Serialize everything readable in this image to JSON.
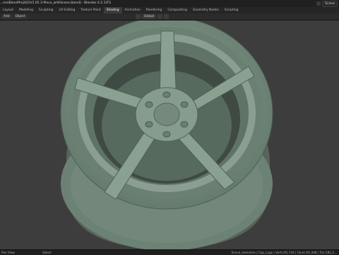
{
  "window": {
    "title": "...ms\\BlendProj\\02\\V1.05 3-Piece_withScene.blend] - Blender 4.2.1LTS",
    "scene_label": "Scene"
  },
  "workspace_tabs": [
    {
      "label": "Layout",
      "active": false
    },
    {
      "label": "Modeling",
      "active": false
    },
    {
      "label": "Sculpting",
      "active": false
    },
    {
      "label": "UV Editing",
      "active": false
    },
    {
      "label": "Texture Paint",
      "active": false
    },
    {
      "label": "Shading",
      "active": true
    },
    {
      "label": "Animation",
      "active": false
    },
    {
      "label": "Rendering",
      "active": false
    },
    {
      "label": "Compositing",
      "active": false
    },
    {
      "label": "Geometry Nodes",
      "active": false
    },
    {
      "label": "Scripting",
      "active": false
    }
  ],
  "header": {
    "add_menu": "Add",
    "object_menu": "Object",
    "orientation": "Global"
  },
  "viewport": {
    "background": "#3d3d3d",
    "model_color": "#7e9384",
    "spoke_count": 5,
    "lug_count": 6
  },
  "status": {
    "left": "Pan View",
    "mid": "Select",
    "right": "Scene_elements | Cap_Lugs | Verts:91,744 | Faces:91,448 | Tris:181,2..."
  }
}
